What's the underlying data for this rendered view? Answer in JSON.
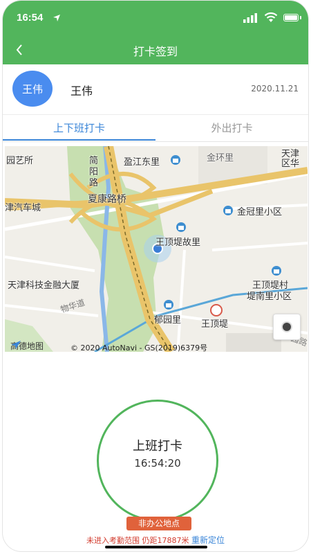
{
  "status_bar": {
    "time": "16:54"
  },
  "nav": {
    "title": "打卡签到",
    "back_icon": "chevron-left-icon"
  },
  "profile": {
    "avatar_text": "王伟",
    "name": "王伟",
    "date": "2020.11.21"
  },
  "tabs": [
    {
      "label": "上下班打卡",
      "active": true
    },
    {
      "label": "外出打卡",
      "active": false
    }
  ],
  "map": {
    "labels": {
      "l1": "园艺所",
      "l2": "简",
      "l3": "阳",
      "l4": "路",
      "l5": "盈江东里",
      "l6": "金环里",
      "l7": "天津",
      "l8": "区华",
      "l9": "夏康路桥",
      "l10": "津汽车城",
      "l11": "金冠里小区",
      "l12": "王顶堤故里",
      "l13": "天津科技金融大厦",
      "l14": "王顶堤村",
      "l15": "堤南里小区",
      "l16": "物华道",
      "l17": "郁园里",
      "l18": "王顶堤",
      "l19": "园路"
    },
    "logo_text": "高德地图",
    "copyright": "© 2020 AutoNavi - GS(2019)6379号"
  },
  "checkin": {
    "label": "上班打卡",
    "time": "16:54:20"
  },
  "badge": "非办公地点",
  "warning": "未进入考勤范围 仍距17887米",
  "relocate": "重新定位",
  "colors": {
    "brand": "#52b55c",
    "accent": "#3b86d8",
    "warning": "#d23a2c",
    "badge": "#e0623b",
    "avatar": "#4a8cef"
  }
}
